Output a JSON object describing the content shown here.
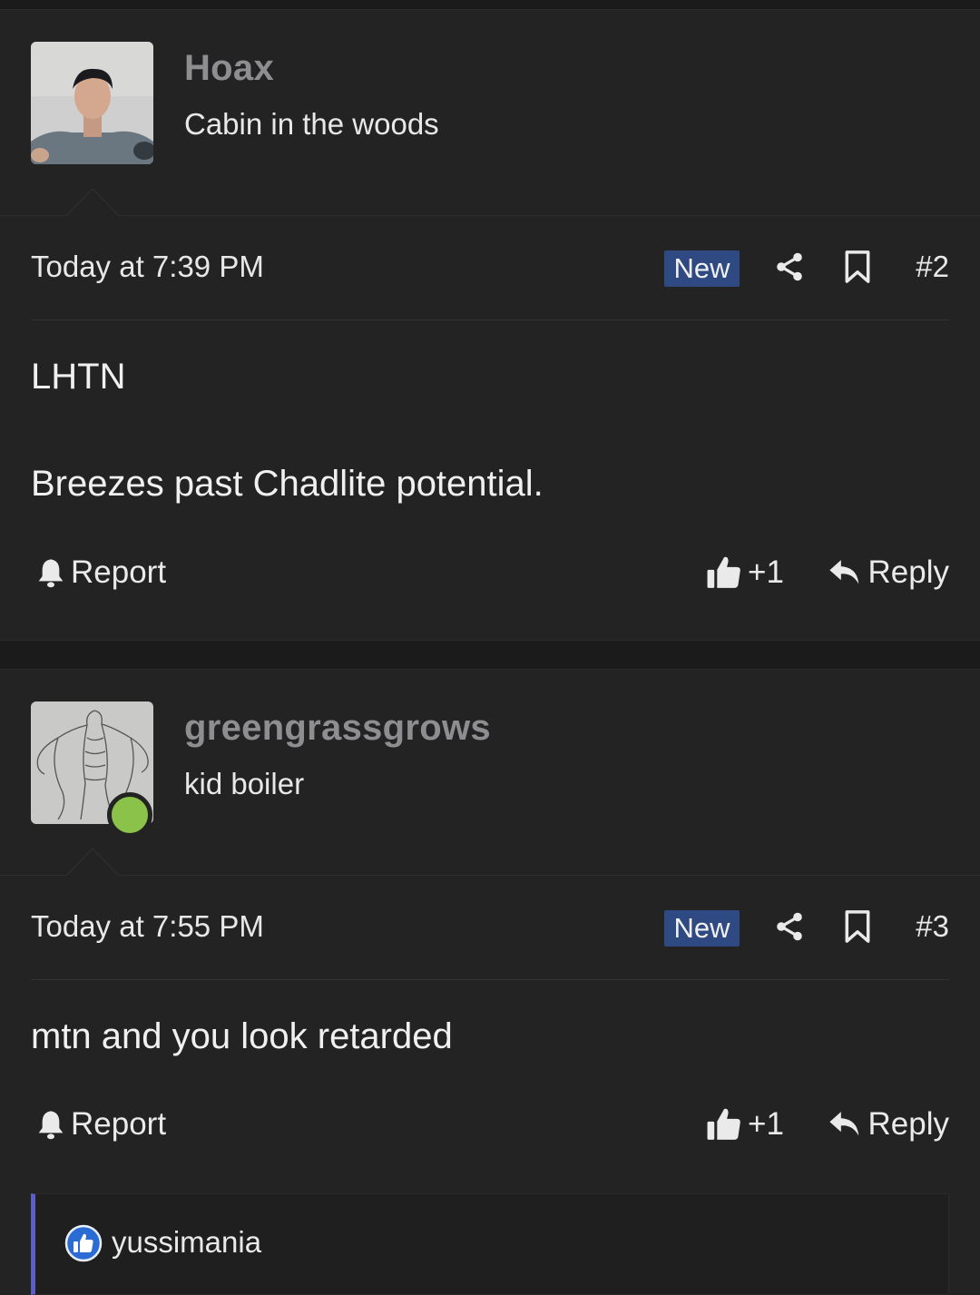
{
  "posts": [
    {
      "username": "Hoax",
      "user_title": "Cabin in the woods",
      "time": "Today at 7:39 PM",
      "badge": "New",
      "number": "#2",
      "content": [
        "LHTN",
        "Breezes past Chadlite potential."
      ],
      "report_label": "Report",
      "like_label": "+1",
      "reply_label": "Reply",
      "online": false
    },
    {
      "username": "greengrassgrows",
      "user_title": "kid boiler",
      "time": "Today at 7:55 PM",
      "badge": "New",
      "number": "#3",
      "content": [
        "mtn and you look retarded"
      ],
      "report_label": "Report",
      "like_label": "+1",
      "reply_label": "Reply",
      "online": true,
      "reactions": {
        "user": "yussimania",
        "icon": "thumbs-up-reaction-icon"
      }
    }
  ],
  "colors": {
    "background": "#1b1b1c",
    "post_background": "#232324",
    "badge_new": "#2f4a82",
    "online": "#8bc34a",
    "reaction_accent": "#5b5fc7",
    "username": "#8e8e90"
  }
}
